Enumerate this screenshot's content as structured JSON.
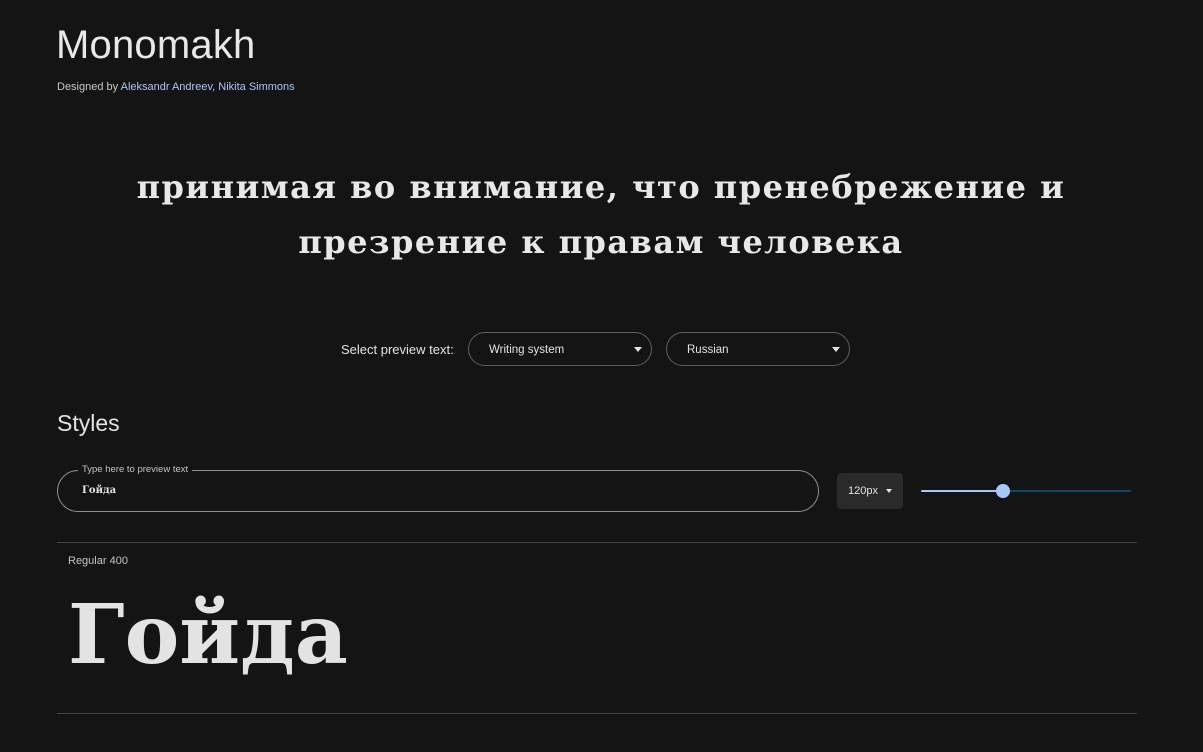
{
  "font": {
    "title": "Monomakh",
    "designed_by_prefix": "Designed by ",
    "designers": [
      "Aleksandr Andreev",
      "Nikita Simmons"
    ],
    "designer_separator": ", "
  },
  "hero_text": "принимая во внимание, что пренебрежение и презрение к правам человека",
  "preview_select": {
    "label": "Select preview text:",
    "writing_system": "Writing system",
    "language": "Russian"
  },
  "styles_section": {
    "heading": "Styles",
    "input_legend": "Type here to preview text",
    "input_value": "Гойда",
    "size_value": "120px",
    "slider_level_percent": 39
  },
  "styles": [
    {
      "name": "Regular 400",
      "sample": "Гойда"
    }
  ],
  "colors": {
    "background": "#141414",
    "accent": "#a8c7fa",
    "slider_rest": "#0b4a6f"
  }
}
